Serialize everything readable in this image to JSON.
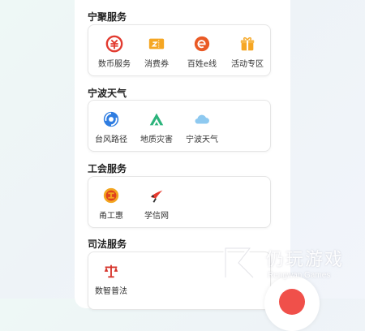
{
  "sections": [
    {
      "title": "宁聚服务",
      "items": [
        {
          "label": "数币服务",
          "icon": "digital-currency-icon"
        },
        {
          "label": "消费券",
          "icon": "coupon-icon"
        },
        {
          "label": "百姓e线",
          "icon": "e-line-icon"
        },
        {
          "label": "活动专区",
          "icon": "gift-icon"
        }
      ]
    },
    {
      "title": "宁波天气",
      "items": [
        {
          "label": "台风路径",
          "icon": "typhoon-icon"
        },
        {
          "label": "地质灾害",
          "icon": "geological-hazard-icon"
        },
        {
          "label": "宁波天气",
          "icon": "cloud-icon"
        }
      ]
    },
    {
      "title": "工会服务",
      "items": [
        {
          "label": "甬工惠",
          "icon": "union-emblem-icon"
        },
        {
          "label": "学信网",
          "icon": "xuexin-bird-icon"
        }
      ]
    },
    {
      "title": "司法服务",
      "items": [
        {
          "label": "数智普法",
          "icon": "scales-icon"
        }
      ]
    }
  ],
  "watermark": {
    "title": "仍玩游戏",
    "subtitle": "Rengwan Games"
  },
  "colors": {
    "red": "#e94b3c",
    "orange": "#f5a623",
    "blue": "#2f7de1",
    "green": "#2bb37b",
    "light_blue": "#8ec9f0"
  }
}
